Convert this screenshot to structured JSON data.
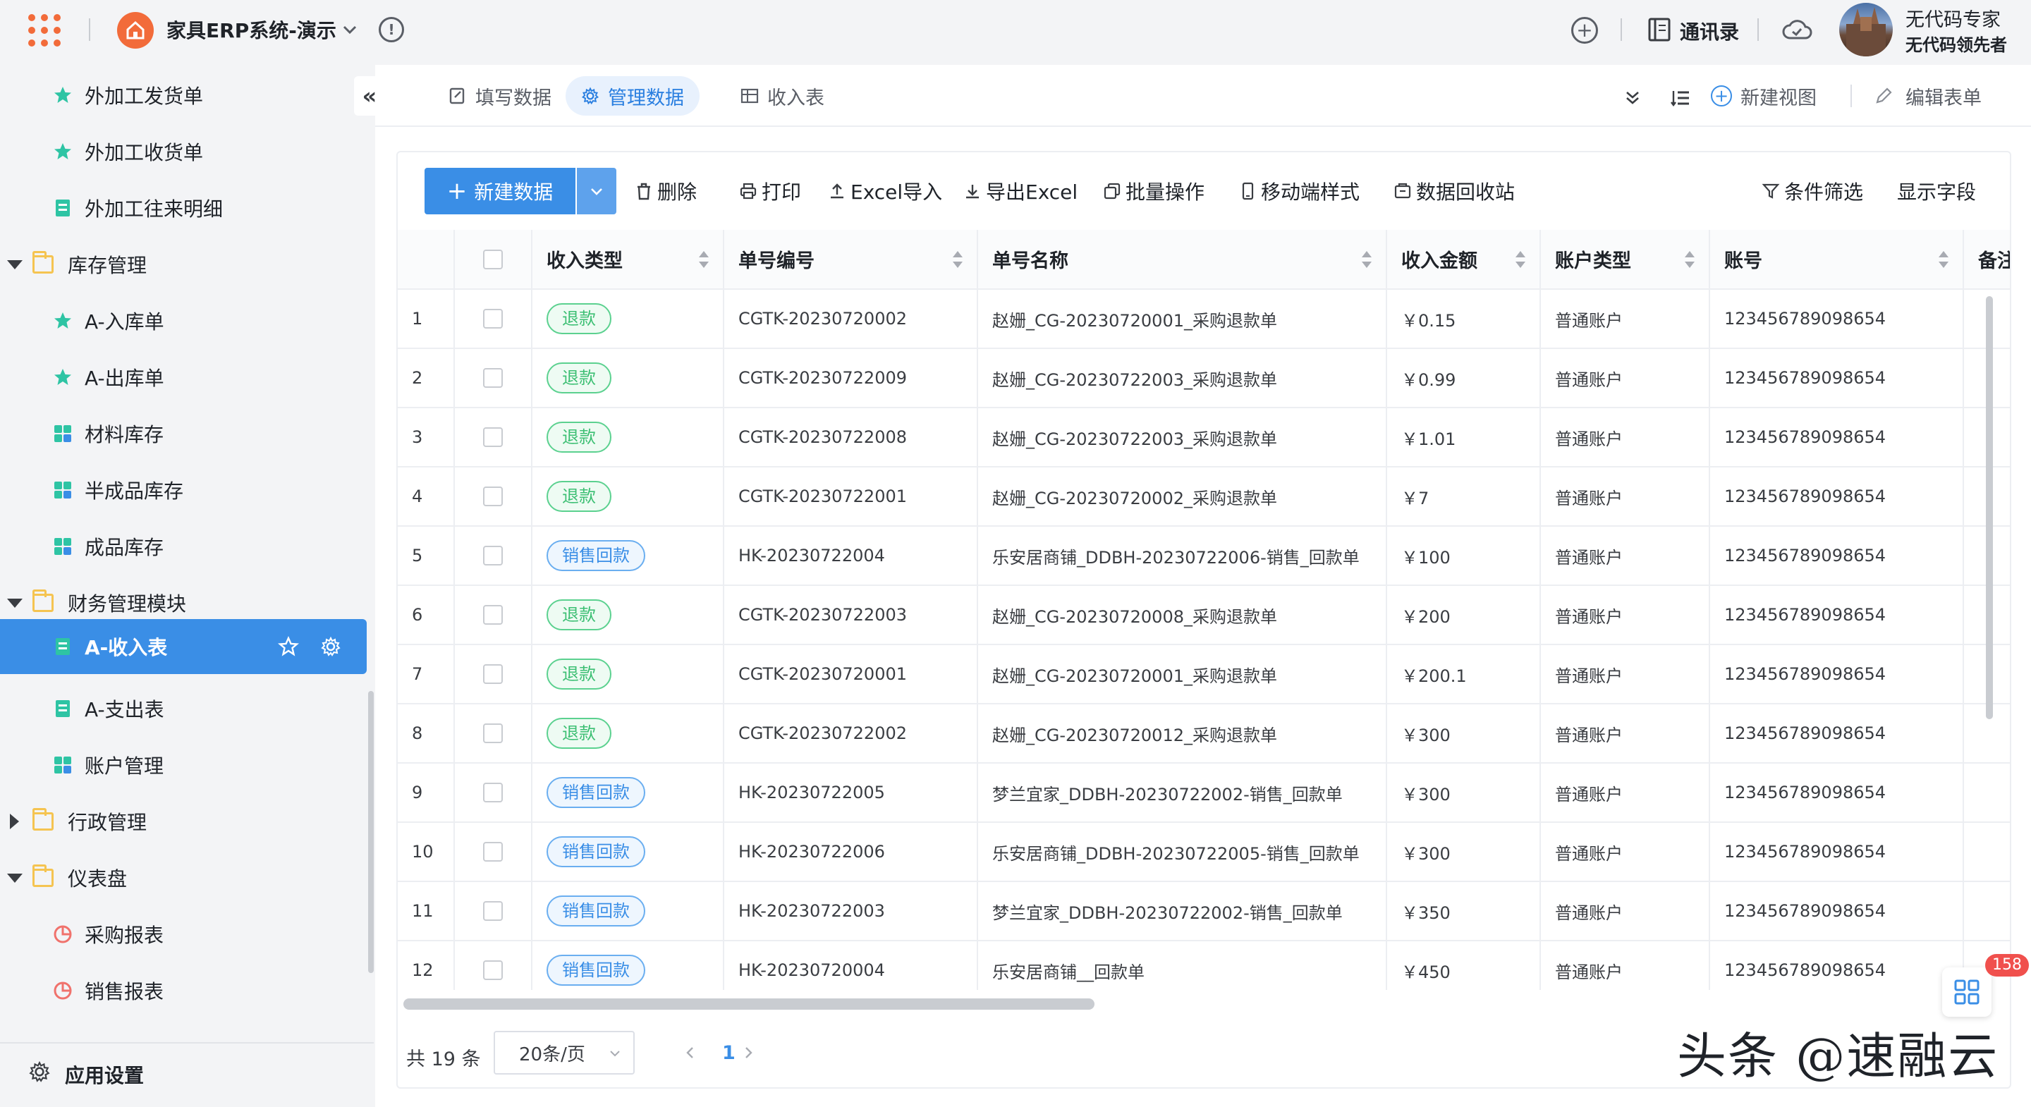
{
  "topbar": {
    "app_title": "家具ERP系统-演示",
    "contacts_label": "通讯录",
    "user_name": "无代码专家",
    "user_role": "无代码领先者"
  },
  "sidebar": {
    "items": [
      {
        "label": "外加工发货单",
        "icon": "star-outline-icon"
      },
      {
        "label": "外加工收货单",
        "icon": "star-icon"
      },
      {
        "label": "外加工往来明细",
        "icon": "form-icon"
      },
      {
        "label": "库存管理",
        "icon": "folder-icon"
      },
      {
        "label": "A-入库单",
        "icon": "star-icon"
      },
      {
        "label": "A-出库单",
        "icon": "star-icon"
      },
      {
        "label": "材料库存",
        "icon": "grid-icon"
      },
      {
        "label": "半成品库存",
        "icon": "grid-icon"
      },
      {
        "label": "成品库存",
        "icon": "grid-icon"
      },
      {
        "label": "财务管理模块",
        "icon": "folder-icon"
      },
      {
        "label": "A-收入表",
        "icon": "form-icon"
      },
      {
        "label": "A-支出表",
        "icon": "form-icon"
      },
      {
        "label": "账户管理",
        "icon": "grid-icon"
      },
      {
        "label": "行政管理",
        "icon": "folder-icon"
      },
      {
        "label": "仪表盘",
        "icon": "folder-icon"
      },
      {
        "label": "采购报表",
        "icon": "pie-icon"
      },
      {
        "label": "销售报表",
        "icon": "pie-icon"
      }
    ],
    "settings_label": "应用设置"
  },
  "tabs": [
    {
      "label": "填写数据"
    },
    {
      "label": "管理数据"
    },
    {
      "label": "收入表"
    }
  ],
  "actions": {
    "new_view": "新建视图",
    "edit_form": "编辑表单"
  },
  "toolbar": {
    "new_data": "新建数据",
    "delete": "删除",
    "print": "打印",
    "excel_import": "Excel导入",
    "export_excel": "导出Excel",
    "batch": "批量操作",
    "mobile_style": "移动端样式",
    "recycle": "数据回收站",
    "filter": "条件筛选",
    "show_fields": "显示字段"
  },
  "table": {
    "columns": [
      "收入类型",
      "单号编号",
      "单号名称",
      "收入金额",
      "账户类型",
      "账号",
      "备注"
    ],
    "rows": [
      {
        "n": "1",
        "type": "退款",
        "kind": "refund",
        "code": "CGTK-20230720002",
        "name": "赵姗_CG-20230720001_采购退款单",
        "amount": "￥0.15",
        "acct_type": "普通账户",
        "acct": "123456789098654"
      },
      {
        "n": "2",
        "type": "退款",
        "kind": "refund",
        "code": "CGTK-20230722009",
        "name": "赵姗_CG-20230722003_采购退款单",
        "amount": "￥0.99",
        "acct_type": "普通账户",
        "acct": "123456789098654"
      },
      {
        "n": "3",
        "type": "退款",
        "kind": "refund",
        "code": "CGTK-20230722008",
        "name": "赵姗_CG-20230722003_采购退款单",
        "amount": "￥1.01",
        "acct_type": "普通账户",
        "acct": "123456789098654"
      },
      {
        "n": "4",
        "type": "退款",
        "kind": "refund",
        "code": "CGTK-20230722001",
        "name": "赵姗_CG-20230720002_采购退款单",
        "amount": "￥7",
        "acct_type": "普通账户",
        "acct": "123456789098654"
      },
      {
        "n": "5",
        "type": "销售回款",
        "kind": "sale",
        "code": "HK-20230722004",
        "name": "乐安居商铺_DDBH-20230722006-销售_回款单",
        "amount": "￥100",
        "acct_type": "普通账户",
        "acct": "123456789098654"
      },
      {
        "n": "6",
        "type": "退款",
        "kind": "refund",
        "code": "CGTK-20230722003",
        "name": "赵姗_CG-20230720008_采购退款单",
        "amount": "￥200",
        "acct_type": "普通账户",
        "acct": "123456789098654"
      },
      {
        "n": "7",
        "type": "退款",
        "kind": "refund",
        "code": "CGTK-20230720001",
        "name": "赵姗_CG-20230720001_采购退款单",
        "amount": "￥200.1",
        "acct_type": "普通账户",
        "acct": "123456789098654"
      },
      {
        "n": "8",
        "type": "退款",
        "kind": "refund",
        "code": "CGTK-20230722002",
        "name": "赵姗_CG-20230720012_采购退款单",
        "amount": "￥300",
        "acct_type": "普通账户",
        "acct": "123456789098654"
      },
      {
        "n": "9",
        "type": "销售回款",
        "kind": "sale",
        "code": "HK-20230722005",
        "name": "梦兰宜家_DDBH-20230722002-销售_回款单",
        "amount": "￥300",
        "acct_type": "普通账户",
        "acct": "123456789098654"
      },
      {
        "n": "10",
        "type": "销售回款",
        "kind": "sale",
        "code": "HK-20230722006",
        "name": "乐安居商铺_DDBH-20230722005-销售_回款单",
        "amount": "￥300",
        "acct_type": "普通账户",
        "acct": "123456789098654"
      },
      {
        "n": "11",
        "type": "销售回款",
        "kind": "sale",
        "code": "HK-20230722003",
        "name": "梦兰宜家_DDBH-20230722002-销售_回款单",
        "amount": "￥350",
        "acct_type": "普通账户",
        "acct": "123456789098654"
      },
      {
        "n": "12",
        "type": "销售回款",
        "kind": "sale",
        "code": "HK-20230720004",
        "name": "乐安居商铺__回款单",
        "amount": "￥450",
        "acct_type": "普通账户",
        "acct": "123456789098654"
      }
    ]
  },
  "pager": {
    "total": "共 19 条",
    "page_size": "20条/页",
    "current_page": "1"
  },
  "badge": "158",
  "watermark": "头条 @速融云",
  "colors": {
    "accent": "#3a8ee6",
    "brand": "#f26b3a",
    "refund": "#3cbf73"
  }
}
